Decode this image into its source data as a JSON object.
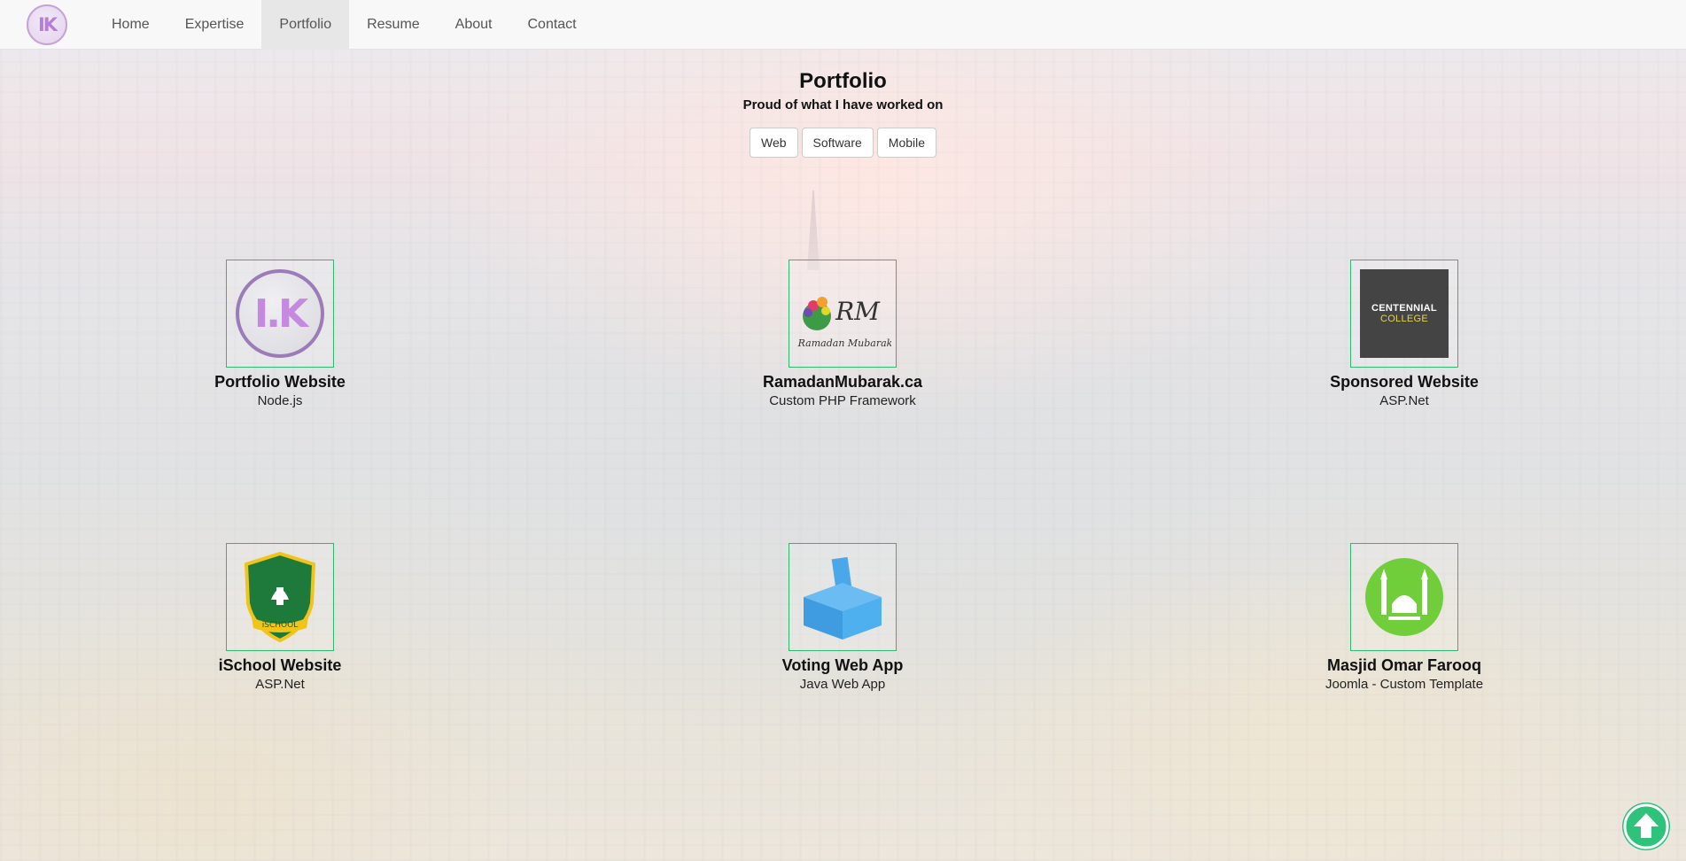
{
  "brand": {
    "text": "IK",
    "icon": "ik-logo-icon"
  },
  "nav": {
    "items": [
      {
        "label": "Home",
        "active": false
      },
      {
        "label": "Expertise",
        "active": false
      },
      {
        "label": "Portfolio",
        "active": true
      },
      {
        "label": "Resume",
        "active": false
      },
      {
        "label": "About",
        "active": false
      },
      {
        "label": "Contact",
        "active": false
      }
    ]
  },
  "section": {
    "title": "Portfolio",
    "subtitle": "Proud of what I have worked on"
  },
  "filters": [
    "Web",
    "Software",
    "Mobile"
  ],
  "portfolio": [
    {
      "title": "Portfolio Website",
      "subtitle": "Node.js",
      "logo": "ik-logo-icon",
      "logo_text": "I.K"
    },
    {
      "title": "RamadanMubarak.ca",
      "subtitle": "Custom PHP Framework",
      "logo": "ramadan-mubarak-logo-icon",
      "logo_text": "RM",
      "logo_caption": "Ramadan Mubarak"
    },
    {
      "title": "Sponsored Website",
      "subtitle": "ASP.Net",
      "logo": "centennial-college-logo-icon",
      "logo_text": "CENTENNIAL",
      "logo_caption": "COLLEGE"
    },
    {
      "title": "iSchool Website",
      "subtitle": "ASP.Net",
      "logo": "ischool-shield-icon",
      "logo_text": "iSCHOOL"
    },
    {
      "title": "Voting Web App",
      "subtitle": "Java Web App",
      "logo": "ballot-box-icon"
    },
    {
      "title": "Masjid Omar Farooq",
      "subtitle": "Joomla - Custom Template",
      "logo": "mosque-logo-icon"
    }
  ],
  "colors": {
    "accent": "#2eb872",
    "scroll_button": "#2fc27b",
    "navbar_bg": "#f8f8f8",
    "nav_active_bg": "#e7e7e7"
  },
  "scroll_top": {
    "icon": "arrow-up-circle-icon"
  }
}
